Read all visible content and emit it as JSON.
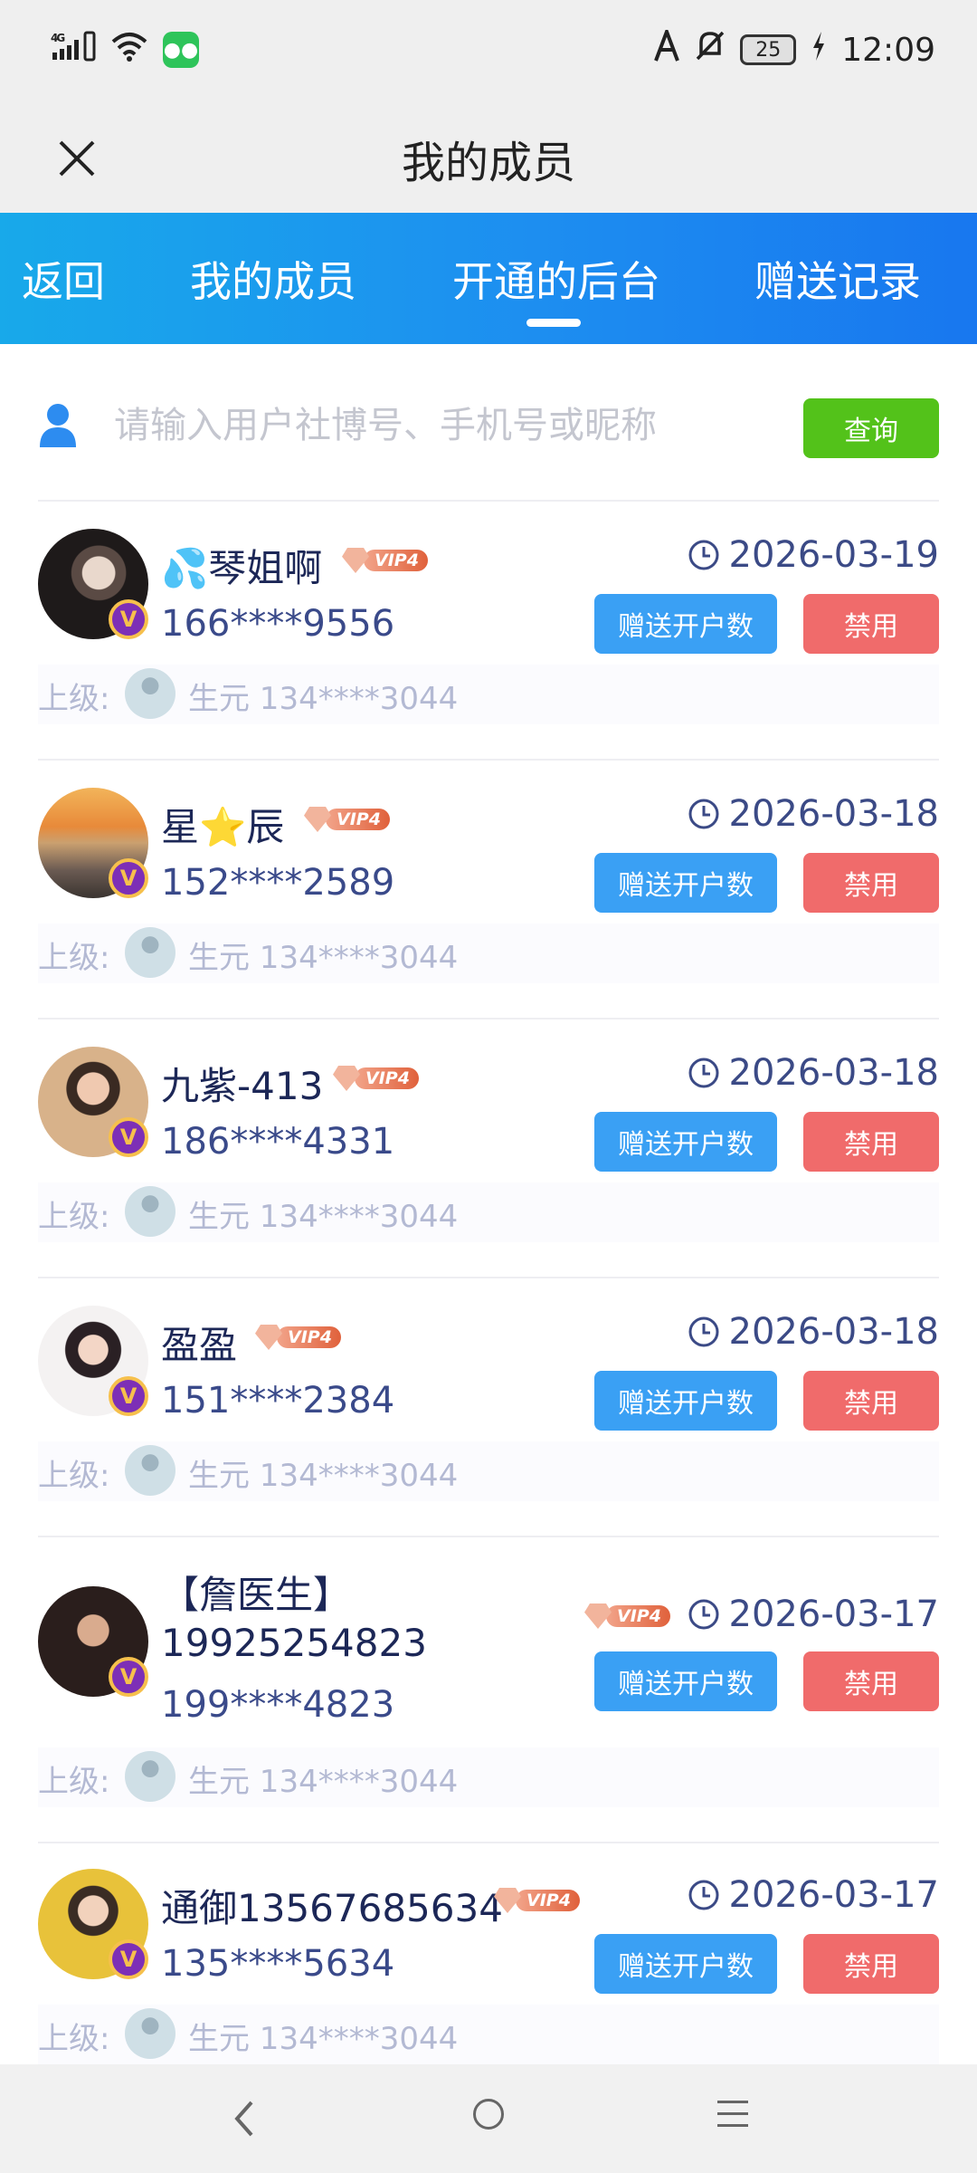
{
  "status_bar": {
    "network": "4G",
    "battery": "25",
    "time": "12:09"
  },
  "header": {
    "title": "我的成员"
  },
  "tabs": {
    "back": "返回",
    "members": "我的成员",
    "opened": "开通的后台",
    "records": "赠送记录"
  },
  "search": {
    "placeholder": "请输入用户社博号、手机号或昵称",
    "button": "查询"
  },
  "member_actions": {
    "gift": "赠送开户数",
    "ban": "禁用",
    "superior_label": "上级:",
    "vip_label": "VIP4"
  },
  "members": [
    {
      "name": "💦琴姐啊",
      "phone": "166****9556",
      "date": "2026-03-19",
      "superior": "生元 134****3044"
    },
    {
      "name": "星⭐辰",
      "phone": "152****2589",
      "date": "2026-03-18",
      "superior": "生元 134****3044"
    },
    {
      "name": "九紫-413",
      "phone": "186****4331",
      "date": "2026-03-18",
      "superior": "生元 134****3044"
    },
    {
      "name": "盈盈",
      "phone": "151****2384",
      "date": "2026-03-18",
      "superior": "生元 134****3044"
    },
    {
      "name": "【詹医生】",
      "name_line2": "19925254823",
      "phone": "199****4823",
      "date": "2026-03-17",
      "superior": "生元 134****3044"
    },
    {
      "name": "通御13567685634",
      "phone": "135****5634",
      "date": "2026-03-17",
      "superior": "生元 134****3044"
    }
  ],
  "colors": {
    "tab_gradient_start": "#18a9ea",
    "tab_gradient_end": "#1877ef",
    "query_button": "#53c21a",
    "gift_button": "#3aa0f4",
    "ban_button": "#f06b6b",
    "vip_badge": "#7d2fb6"
  }
}
